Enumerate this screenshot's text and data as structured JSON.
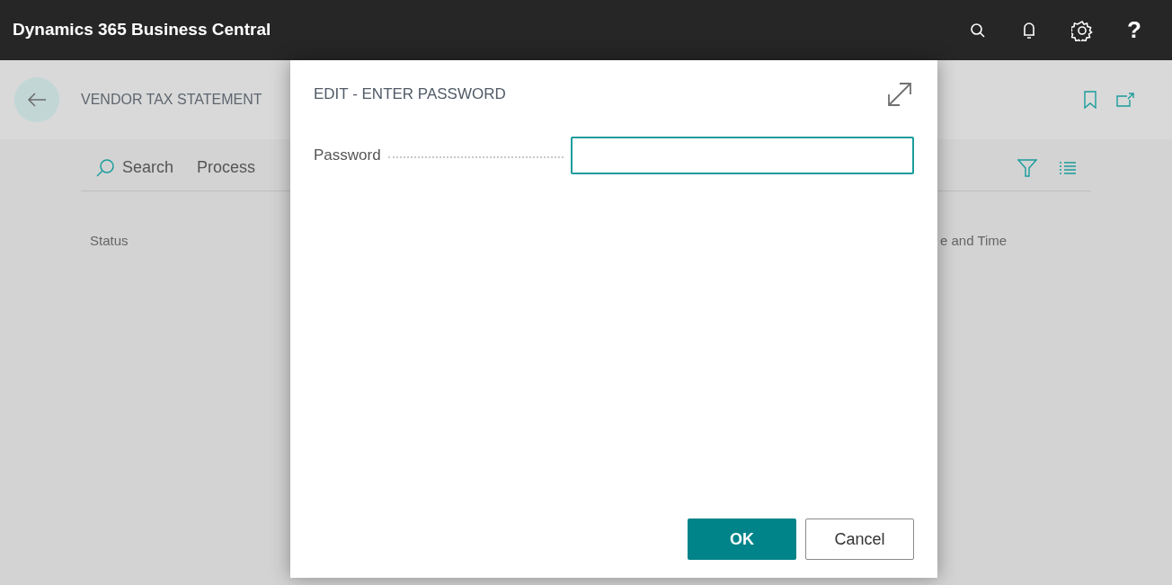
{
  "header": {
    "app_title": "Dynamics 365 Business Central",
    "help_label": "?"
  },
  "page": {
    "title": "VENDOR TAX STATEMENT",
    "actions": [
      "Search",
      "Process"
    ],
    "columns": [
      "Status",
      "e and Time"
    ]
  },
  "dialog": {
    "title": "EDIT - ENTER PASSWORD",
    "fields": [
      {
        "label": "Password",
        "focused": true
      }
    ],
    "buttons": [
      {
        "label": "OK",
        "primary": true
      },
      {
        "label": "Cancel",
        "primary": false
      }
    ]
  }
}
